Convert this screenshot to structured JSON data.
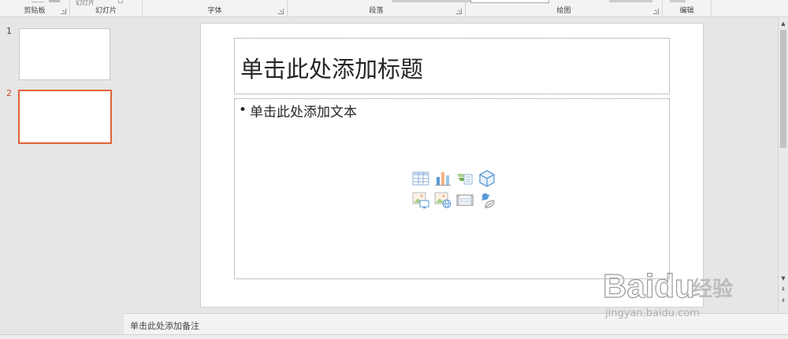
{
  "ribbon": {
    "groups": [
      {
        "label": "剪贴板"
      },
      {
        "label": "幻灯片"
      },
      {
        "label": "字体"
      },
      {
        "label": "段落"
      },
      {
        "label": "绘图"
      },
      {
        "label": "编辑"
      }
    ],
    "partial_items": {
      "new_slide": "幻灯片"
    }
  },
  "thumbnails": {
    "slides": [
      {
        "number": "1"
      },
      {
        "number": "2"
      }
    ],
    "active_index": 2
  },
  "slide": {
    "title_placeholder": "单击此处添加标题",
    "body_bullet": "•",
    "body_placeholder": "单击此处添加文本",
    "insert_icons": [
      "table-icon",
      "chart-icon",
      "smartart-icon",
      "3d-model-icon",
      "picture-icon",
      "online-picture-icon",
      "video-icon",
      "icons-icon"
    ]
  },
  "notes": {
    "placeholder": "单击此处添加备注"
  },
  "watermark": {
    "brand": "Baidu",
    "brand_cn": "经验",
    "url": "jingyan.baidu.com"
  },
  "colors": {
    "accent": "#e0633b",
    "slide_number_active": "#d24726",
    "icon_blue": "#5b9bd5",
    "icon_orange": "#f4b183",
    "icon_green": "#70ad47"
  }
}
